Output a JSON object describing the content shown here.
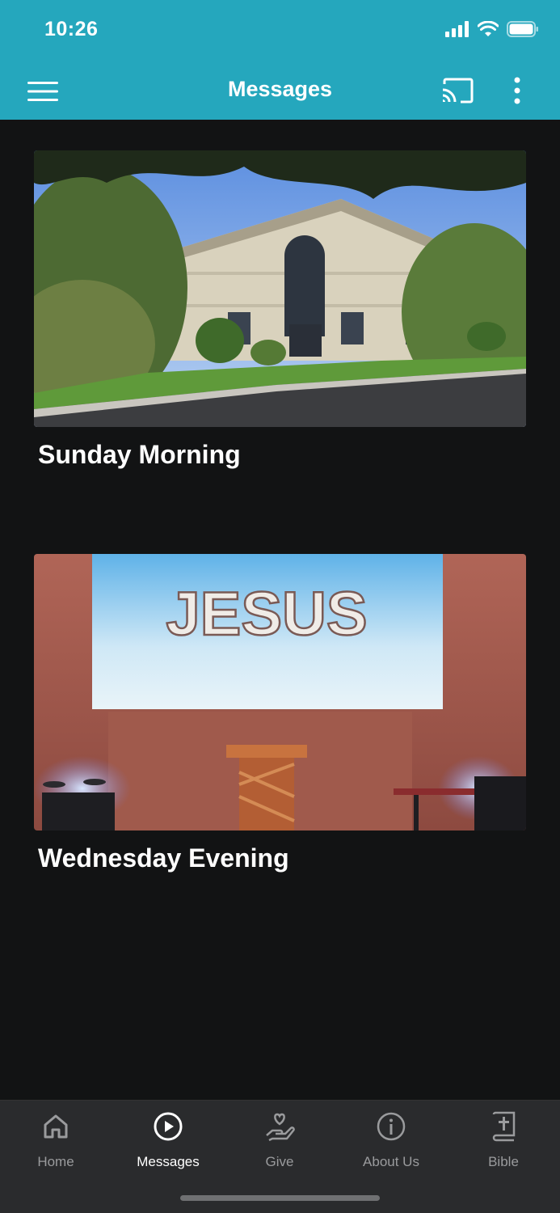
{
  "status": {
    "time": "10:26"
  },
  "header": {
    "title": "Messages"
  },
  "messages": [
    {
      "title": "Sunday Morning"
    },
    {
      "title": "Wednesday Evening",
      "screen_text": "JESUS"
    }
  ],
  "tabs": [
    {
      "label": "Home",
      "icon": "home-icon",
      "active": false
    },
    {
      "label": "Messages",
      "icon": "play-circle-icon",
      "active": true
    },
    {
      "label": "Give",
      "icon": "heart-hand-icon",
      "active": false
    },
    {
      "label": "About Us",
      "icon": "info-icon",
      "active": false
    },
    {
      "label": "Bible",
      "icon": "bible-icon",
      "active": false
    }
  ],
  "colors": {
    "header": "#25a7bd",
    "background": "#121314",
    "tab_bar": "#2a2b2d",
    "tab_inactive": "#9a9b9d",
    "tab_active": "#ffffff"
  }
}
